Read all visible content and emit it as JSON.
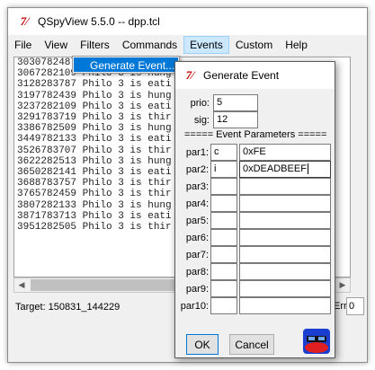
{
  "window": {
    "title": "QSpyView 5.5.0 -- dpp.tcl",
    "logo_glyph": "Tk"
  },
  "menubar": {
    "items": [
      {
        "label": "File"
      },
      {
        "label": "View"
      },
      {
        "label": "Filters"
      },
      {
        "label": "Commands"
      },
      {
        "label": "Events"
      },
      {
        "label": "Custom"
      },
      {
        "label": "Help"
      }
    ],
    "active_menu": "Events"
  },
  "events_menu": {
    "items": [
      {
        "label": "Generate Event..."
      }
    ]
  },
  "log": {
    "lines": [
      "3030782487",
      "3067282109 Philo 3 is hung",
      "3128283787 Philo 3 is eati",
      "3197782439 Philo 3 is hung",
      "3237282109 Philo 3 is eati",
      "3291783719 Philo 3 is thir",
      "3386782509 Philo 3 is hung",
      "3449782133 Philo 3 is eati",
      "3526783707 Philo 3 is thir",
      "3622282513 Philo 3 is hung",
      "3650282141 Philo 3 is eati",
      "3688783757 Philo 3 is thir",
      "3765782459 Philo 3 is thir",
      "3807282133 Philo 3 is hung",
      "3871783713 Philo 3 is eati",
      "3951282505 Philo 3 is thir"
    ]
  },
  "status": {
    "target": "Target: 150831_144229",
    "err_label": "Err",
    "err_value": "0"
  },
  "dialog": {
    "title": "Generate Event",
    "prio_label": "prio:",
    "prio_value": "5",
    "sig_label": "sig:",
    "sig_value": "12",
    "params_header": "===== Event Parameters =====",
    "params": [
      {
        "label": "par1:",
        "type": "c",
        "value": "0xFE"
      },
      {
        "label": "par2:",
        "type": "i",
        "value": "0xDEADBEEF"
      },
      {
        "label": "par3:",
        "type": "",
        "value": ""
      },
      {
        "label": "par4:",
        "type": "",
        "value": ""
      },
      {
        "label": "par5:",
        "type": "",
        "value": ""
      },
      {
        "label": "par6:",
        "type": "",
        "value": ""
      },
      {
        "label": "par7:",
        "type": "",
        "value": ""
      },
      {
        "label": "par8:",
        "type": "",
        "value": ""
      },
      {
        "label": "par9:",
        "type": "",
        "value": ""
      },
      {
        "label": "par10:",
        "type": "",
        "value": ""
      }
    ],
    "ok_label": "OK",
    "cancel_label": "Cancel",
    "mascot_icon": "qspy-mascot-icon"
  }
}
